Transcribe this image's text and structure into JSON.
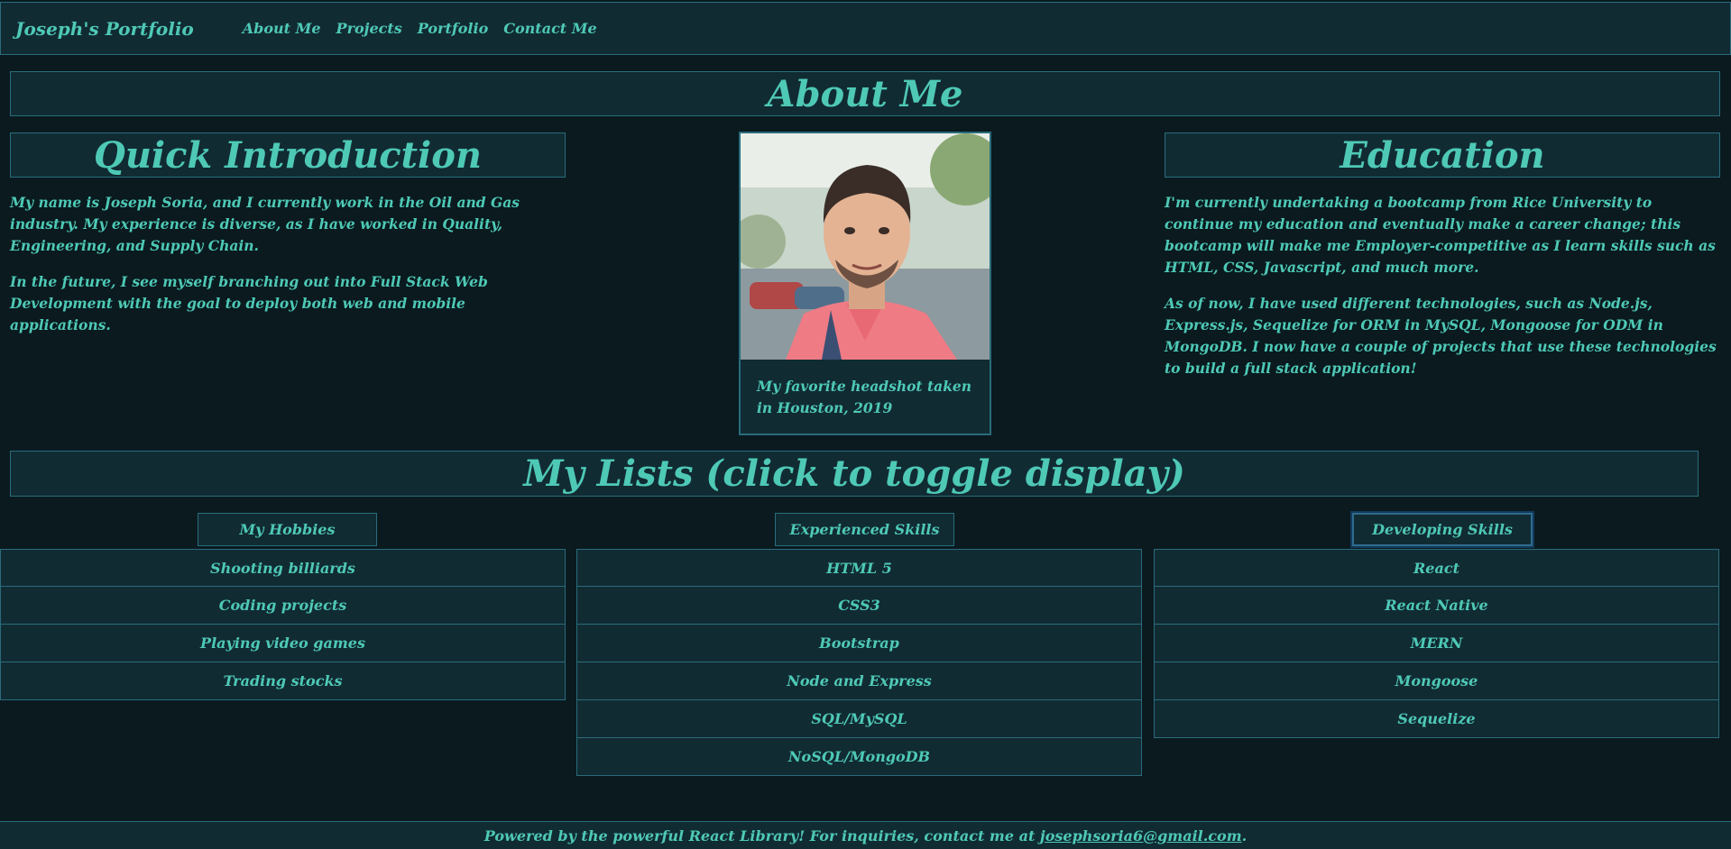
{
  "nav": {
    "brand": "Joseph's Portfolio",
    "links": [
      "About Me",
      "Projects",
      "Portfolio",
      "Contact Me"
    ]
  },
  "about": {
    "title": "About Me"
  },
  "intro": {
    "title": "Quick Introduction",
    "paragraphs": [
      "My name is Joseph Soria, and I currently work in the Oil and Gas industry. My experience is diverse, as I have worked in Quality, Engineering, and Supply Chain.",
      "In the future, I see myself branching out into Full Stack Web Development with the goal to deploy both web and mobile applications."
    ]
  },
  "headshot": {
    "caption": "My favorite headshot taken in Houston, 2019"
  },
  "education": {
    "title": "Education",
    "paragraphs": [
      "I'm currently undertaking a bootcamp from Rice University to continue my education and eventually make a career change; this bootcamp will make me Employer-competitive as I learn skills such as HTML, CSS, Javascript, and much more.",
      "As of now, I have used different technologies, such as Node.js, Express.js, Sequelize for ORM in MySQL, Mongoose for ODM in MongoDB. I now have a couple of projects that use these technologies to build a full stack application!"
    ]
  },
  "lists": {
    "title": "My Lists (click to toggle display)",
    "hobbies": {
      "label": "My Hobbies",
      "items": [
        "Shooting billiards",
        "Coding projects",
        "Playing video games",
        "Trading stocks"
      ]
    },
    "experienced": {
      "label": "Experienced Skills",
      "items": [
        "HTML 5",
        "CSS3",
        "Bootstrap",
        "Node and Express",
        "SQL/MySQL",
        "NoSQL/MongoDB"
      ]
    },
    "developing": {
      "label": "Developing Skills",
      "items": [
        "React",
        "React Native",
        "MERN",
        "Mongoose",
        "Sequelize"
      ]
    }
  },
  "footer": {
    "text": "Powered by the powerful React Library! For inquiries, contact me at ",
    "email": "josephsoria6@gmail.com",
    "suffix": "."
  },
  "colors": {
    "background": "#0a1a1f",
    "panel": "#112b33",
    "border": "#2a6c7c",
    "accent_text": "#4ec9b6"
  }
}
